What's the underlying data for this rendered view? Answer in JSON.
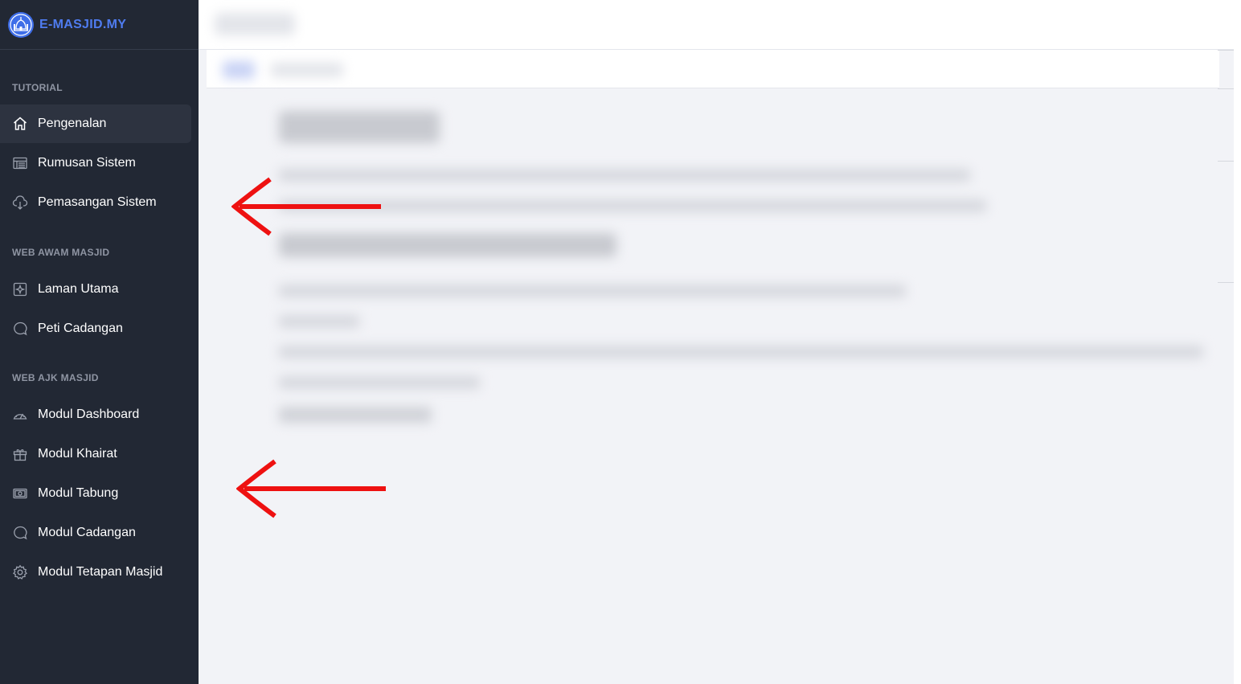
{
  "brand": {
    "name": "E-MASJID.MY"
  },
  "sections": [
    {
      "title": "TUTORIAL",
      "items": [
        {
          "label": "Pengenalan",
          "icon": "home-icon",
          "active": true
        },
        {
          "label": "Rumusan Sistem",
          "icon": "table-icon"
        },
        {
          "label": "Pemasangan Sistem",
          "icon": "cloud-download-icon"
        }
      ]
    },
    {
      "title": "WEB AWAM MASJID",
      "items": [
        {
          "label": "Laman Utama",
          "icon": "sparkle-box-icon"
        },
        {
          "label": "Peti Cadangan",
          "icon": "chat-bubble-icon"
        }
      ]
    },
    {
      "title": "WEB AJK MASJID",
      "items": [
        {
          "label": "Modul Dashboard",
          "icon": "gauge-icon"
        },
        {
          "label": "Modul Khairat",
          "icon": "gift-icon"
        },
        {
          "label": "Modul Tabung",
          "icon": "cash-icon"
        },
        {
          "label": "Modul Cadangan",
          "icon": "chat-bubble-icon"
        },
        {
          "label": "Modul Tetapan Masjid",
          "icon": "gear-icon"
        }
      ]
    }
  ],
  "colors": {
    "sidebar_bg": "#222834",
    "brand": "#4f7cf0",
    "arrow": "#ee1111",
    "content_bg": "#f2f3f7"
  }
}
